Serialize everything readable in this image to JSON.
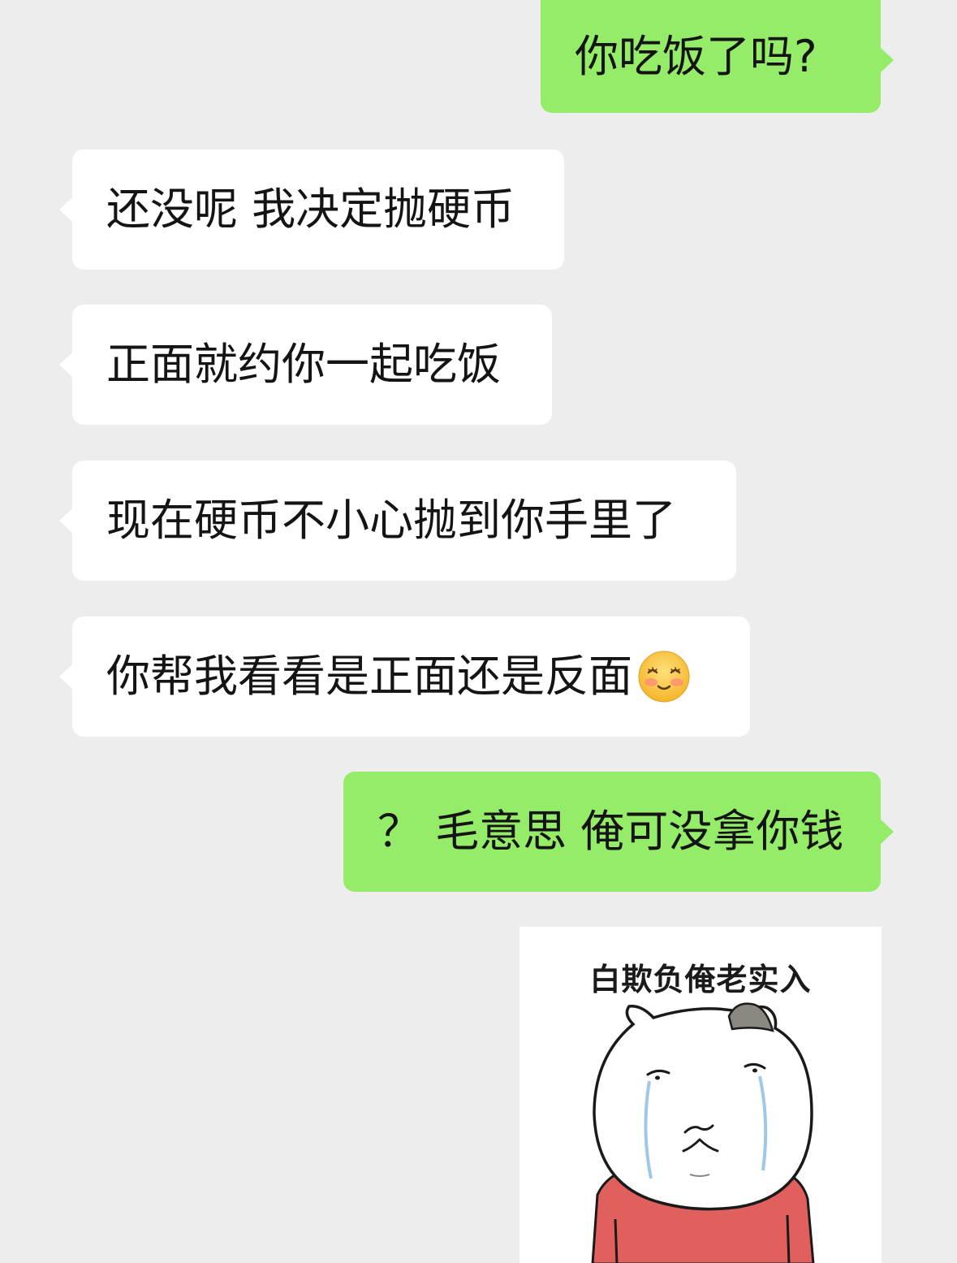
{
  "conversation": {
    "messages": [
      {
        "side": "out",
        "text": "你吃饭了吗?"
      },
      {
        "side": "in",
        "text": "还没呢 我决定抛硬币"
      },
      {
        "side": "in",
        "text": "正面就约你一起吃饭"
      },
      {
        "side": "in",
        "text": "现在硬币不小心抛到你手里了"
      },
      {
        "side": "in",
        "text": "你帮我看看是正面还是反面",
        "emoji": "blushing-smile-emoji"
      },
      {
        "side": "out",
        "text": "？ 毛意思 俺可没拿你钱"
      }
    ],
    "sticker": {
      "caption": "白欺负俺老实入",
      "image": "crying-cat-meme"
    }
  },
  "colors": {
    "background": "#ededed",
    "incoming_bubble": "#ffffff",
    "outgoing_bubble": "#95ec69",
    "text": "#141414"
  }
}
